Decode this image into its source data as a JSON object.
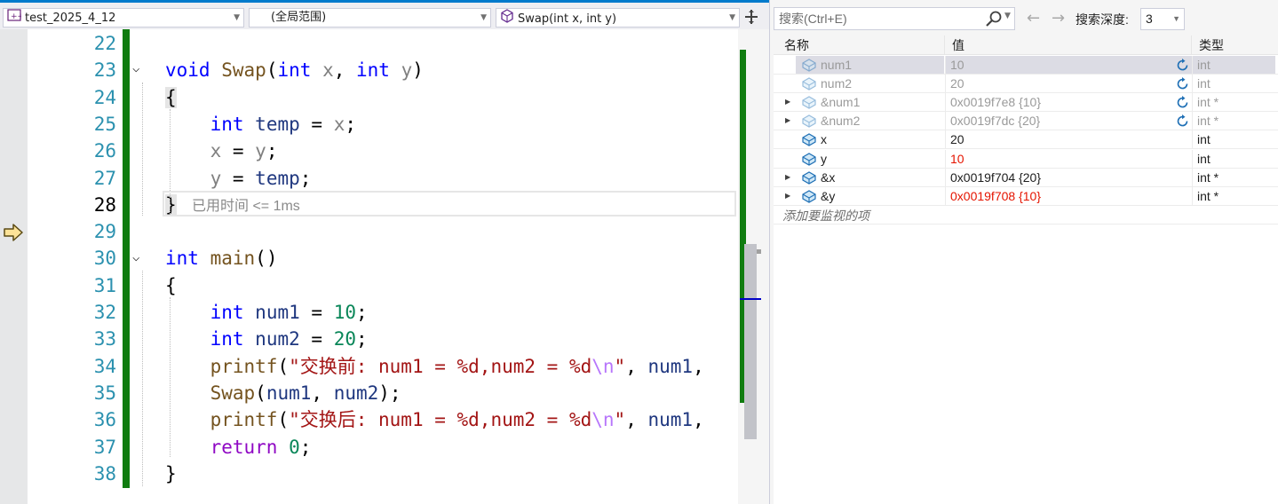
{
  "nav_bar": {
    "project": "test_2025_4_12",
    "scope": "(全局范围)",
    "member": "Swap(int x, int y)"
  },
  "editor": {
    "current_line": 28,
    "perf_tip": "已用时间 <= 1ms",
    "lines": [
      {
        "num": 22,
        "code": []
      },
      {
        "num": 23,
        "code": [
          [
            "kw",
            "void"
          ],
          [
            "t",
            " "
          ],
          [
            "fn",
            "Swap"
          ],
          [
            "t",
            "("
          ],
          [
            "kw",
            "int"
          ],
          [
            "t",
            " "
          ],
          [
            "par",
            "x"
          ],
          [
            "t",
            ", "
          ],
          [
            "kw",
            "int"
          ],
          [
            "t",
            " "
          ],
          [
            "par",
            "y"
          ],
          [
            "t",
            ")"
          ]
        ]
      },
      {
        "num": 24,
        "code": [
          [
            "hl",
            "{"
          ]
        ]
      },
      {
        "num": 25,
        "code": [
          [
            "t",
            "    "
          ],
          [
            "kw",
            "int"
          ],
          [
            "t",
            " "
          ],
          [
            "loc",
            "temp"
          ],
          [
            "t",
            " = "
          ],
          [
            "par",
            "x"
          ],
          [
            "t",
            ";"
          ]
        ]
      },
      {
        "num": 26,
        "code": [
          [
            "t",
            "    "
          ],
          [
            "par",
            "x"
          ],
          [
            "t",
            " = "
          ],
          [
            "par",
            "y"
          ],
          [
            "t",
            ";"
          ]
        ]
      },
      {
        "num": 27,
        "code": [
          [
            "t",
            "    "
          ],
          [
            "par",
            "y"
          ],
          [
            "t",
            " = "
          ],
          [
            "loc",
            "temp"
          ],
          [
            "t",
            ";"
          ]
        ]
      },
      {
        "num": 28,
        "code": [
          [
            "hl",
            "}"
          ]
        ]
      },
      {
        "num": 29,
        "code": []
      },
      {
        "num": 30,
        "code": [
          [
            "kw",
            "int"
          ],
          [
            "t",
            " "
          ],
          [
            "fn",
            "main"
          ],
          [
            "t",
            "()"
          ]
        ]
      },
      {
        "num": 31,
        "code": [
          [
            "t",
            "{"
          ]
        ]
      },
      {
        "num": 32,
        "code": [
          [
            "t",
            "    "
          ],
          [
            "kw",
            "int"
          ],
          [
            "t",
            " "
          ],
          [
            "loc",
            "num1"
          ],
          [
            "t",
            " = "
          ],
          [
            "num",
            "10"
          ],
          [
            "t",
            ";"
          ]
        ]
      },
      {
        "num": 33,
        "code": [
          [
            "t",
            "    "
          ],
          [
            "kw",
            "int"
          ],
          [
            "t",
            " "
          ],
          [
            "loc",
            "num2"
          ],
          [
            "t",
            " = "
          ],
          [
            "num",
            "20"
          ],
          [
            "t",
            ";"
          ]
        ]
      },
      {
        "num": 34,
        "code": [
          [
            "t",
            "    "
          ],
          [
            "fn",
            "printf"
          ],
          [
            "t",
            "("
          ],
          [
            "str",
            "\"交换前: num1 = %d,num2 = %d"
          ],
          [
            "esc",
            "\\n"
          ],
          [
            "str",
            "\""
          ],
          [
            "t",
            ", "
          ],
          [
            "loc",
            "num1"
          ],
          [
            "t",
            ","
          ]
        ]
      },
      {
        "num": 35,
        "code": [
          [
            "t",
            "    "
          ],
          [
            "fn",
            "Swap"
          ],
          [
            "t",
            "("
          ],
          [
            "loc",
            "num1"
          ],
          [
            "t",
            ", "
          ],
          [
            "loc",
            "num2"
          ],
          [
            "t",
            ");"
          ]
        ]
      },
      {
        "num": 36,
        "code": [
          [
            "t",
            "    "
          ],
          [
            "fn",
            "printf"
          ],
          [
            "t",
            "("
          ],
          [
            "str",
            "\"交换后: num1 = %d,num2 = %d"
          ],
          [
            "esc",
            "\\n"
          ],
          [
            "str",
            "\""
          ],
          [
            "t",
            ", "
          ],
          [
            "loc",
            "num1"
          ],
          [
            "t",
            ","
          ]
        ]
      },
      {
        "num": 37,
        "code": [
          [
            "t",
            "    "
          ],
          [
            "ctl",
            "return"
          ],
          [
            "t",
            " "
          ],
          [
            "num",
            "0"
          ],
          [
            "t",
            ";"
          ]
        ]
      },
      {
        "num": 38,
        "code": [
          [
            "t",
            "}"
          ]
        ]
      }
    ]
  },
  "watch": {
    "search_placeholder": "搜索(Ctrl+E)",
    "depth_label": "搜索深度:",
    "depth_value": "3",
    "columns": {
      "name": "名称",
      "value": "值",
      "type": "类型"
    },
    "rows": [
      {
        "name": "num1",
        "value": "10",
        "type": "int",
        "stale": true,
        "expandable": false,
        "refresh": true,
        "selected": true,
        "changed": false
      },
      {
        "name": "num2",
        "value": "20",
        "type": "int",
        "stale": true,
        "expandable": false,
        "refresh": true,
        "selected": false,
        "changed": false
      },
      {
        "name": "&num1",
        "value": "0x0019f7e8 {10}",
        "type": "int *",
        "stale": true,
        "expandable": true,
        "refresh": true,
        "selected": false,
        "changed": false
      },
      {
        "name": "&num2",
        "value": "0x0019f7dc {20}",
        "type": "int *",
        "stale": true,
        "expandable": true,
        "refresh": true,
        "selected": false,
        "changed": false
      },
      {
        "name": "x",
        "value": "20",
        "type": "int",
        "stale": false,
        "expandable": false,
        "refresh": false,
        "selected": false,
        "changed": false
      },
      {
        "name": "y",
        "value": "10",
        "type": "int",
        "stale": false,
        "expandable": false,
        "refresh": false,
        "selected": false,
        "changed": true
      },
      {
        "name": "&x",
        "value": "0x0019f704 {20}",
        "type": "int *",
        "stale": false,
        "expandable": true,
        "refresh": false,
        "selected": false,
        "changed": false
      },
      {
        "name": "&y",
        "value": "0x0019f708 {10}",
        "type": "int *",
        "stale": false,
        "expandable": true,
        "refresh": false,
        "selected": false,
        "changed": true
      }
    ],
    "add_item": "添加要监视的项"
  },
  "colors": {
    "accent": "#007acc",
    "change_bar": "#107c10",
    "changed_value": "#e51400",
    "keyword": "#0000ff"
  }
}
